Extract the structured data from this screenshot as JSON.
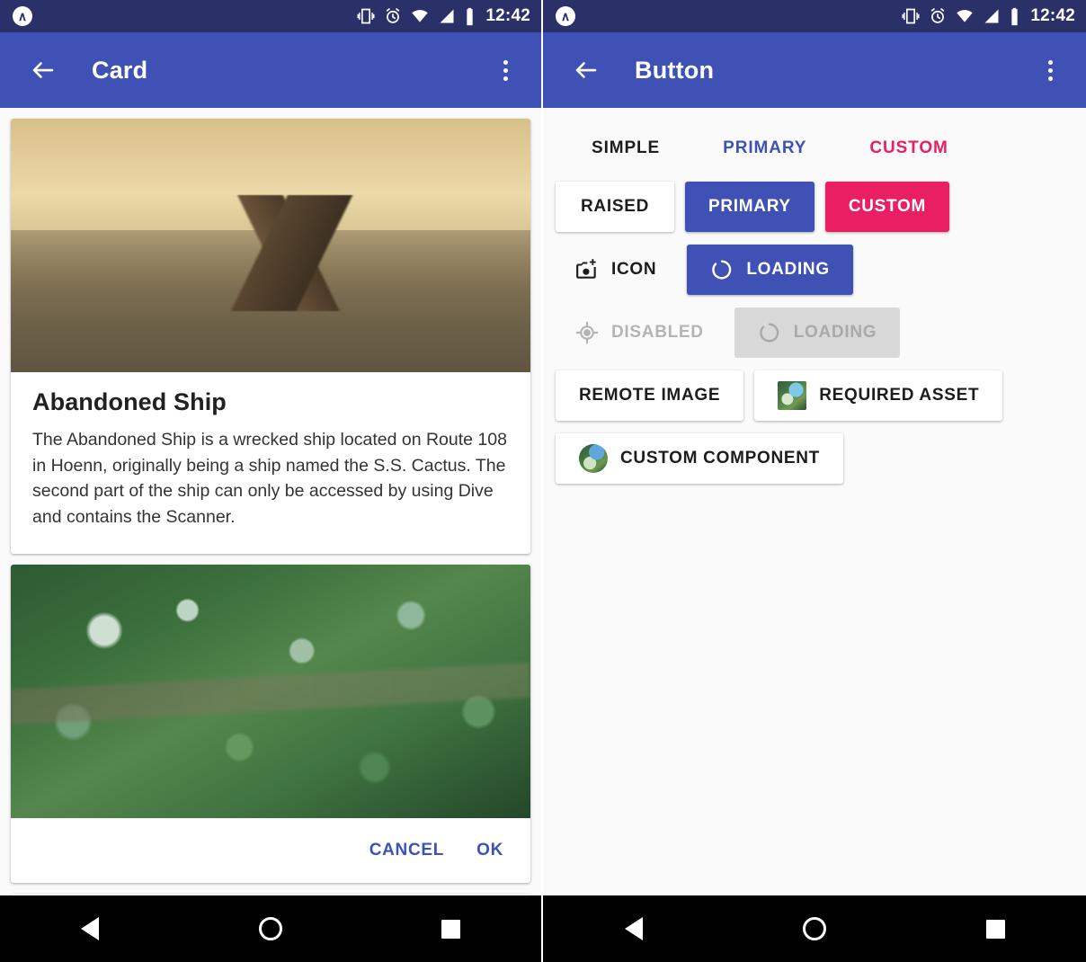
{
  "statusbar": {
    "time": "12:42",
    "icons": [
      "app-badge-icon",
      "vibrate-icon",
      "alarm-icon",
      "wifi-icon",
      "signal-icon",
      "battery-icon"
    ],
    "app_badge_glyph": "∧",
    "background_color": "#2a3168"
  },
  "colors": {
    "primary": "#3f51b5",
    "accent_pink": "#e91e63",
    "background": "#fafafa",
    "card_surface": "#ffffff",
    "disabled_text": "#b4b4b4",
    "disabled_surface": "#d8d8d8"
  },
  "left_screen": {
    "toolbar": {
      "title": "Card",
      "back_label": "←",
      "overflow_label": "more-options"
    },
    "cards": [
      {
        "image_name": "abandoned-ship-photo",
        "title": "Abandoned Ship",
        "body": "The Abandoned Ship is a wrecked ship located on Route 108 in Hoenn, originally being a ship named the S.S. Cactus. The second part of the ship can only be accessed by using Dive and contains the Scanner."
      },
      {
        "image_name": "forest-aerial-photo",
        "actions": [
          {
            "label": "CANCEL"
          },
          {
            "label": "OK"
          }
        ]
      }
    ]
  },
  "right_screen": {
    "toolbar": {
      "title": "Button",
      "back_label": "←",
      "overflow_label": "more-options"
    },
    "tabs": [
      {
        "label": "SIMPLE",
        "color": "#1d1d1d"
      },
      {
        "label": "PRIMARY",
        "color": "#3f51b5"
      },
      {
        "label": "CUSTOM",
        "color": "#e91e63"
      }
    ],
    "rows": [
      {
        "buttons": [
          {
            "label": "RAISED",
            "style": "raised"
          },
          {
            "label": "PRIMARY",
            "style": "primary"
          },
          {
            "label": "CUSTOM",
            "style": "custom"
          }
        ]
      },
      {
        "buttons": [
          {
            "label": "ICON",
            "style": "flat",
            "icon": "add-a-photo-icon"
          },
          {
            "label": "LOADING",
            "style": "primary",
            "icon": "spinner-icon"
          }
        ]
      },
      {
        "buttons": [
          {
            "label": "DISABLED",
            "style": "disabled",
            "icon": "gps-fixed-icon"
          },
          {
            "label": "LOADING",
            "style": "loading-disabled",
            "icon": "spinner-icon"
          }
        ]
      },
      {
        "buttons": [
          {
            "label": "REMOTE IMAGE",
            "style": "outline"
          },
          {
            "label": "REQUIRED ASSET",
            "style": "outline",
            "icon": "image-thumbnail-square"
          }
        ]
      },
      {
        "buttons": [
          {
            "label": "CUSTOM COMPONENT",
            "style": "outline",
            "icon": "image-thumbnail-circle"
          }
        ]
      }
    ]
  },
  "navbar": {
    "items": [
      {
        "name": "back-nav-button",
        "glyph": "triangle-left"
      },
      {
        "name": "home-nav-button",
        "glyph": "circle"
      },
      {
        "name": "recents-nav-button",
        "glyph": "square"
      }
    ]
  }
}
